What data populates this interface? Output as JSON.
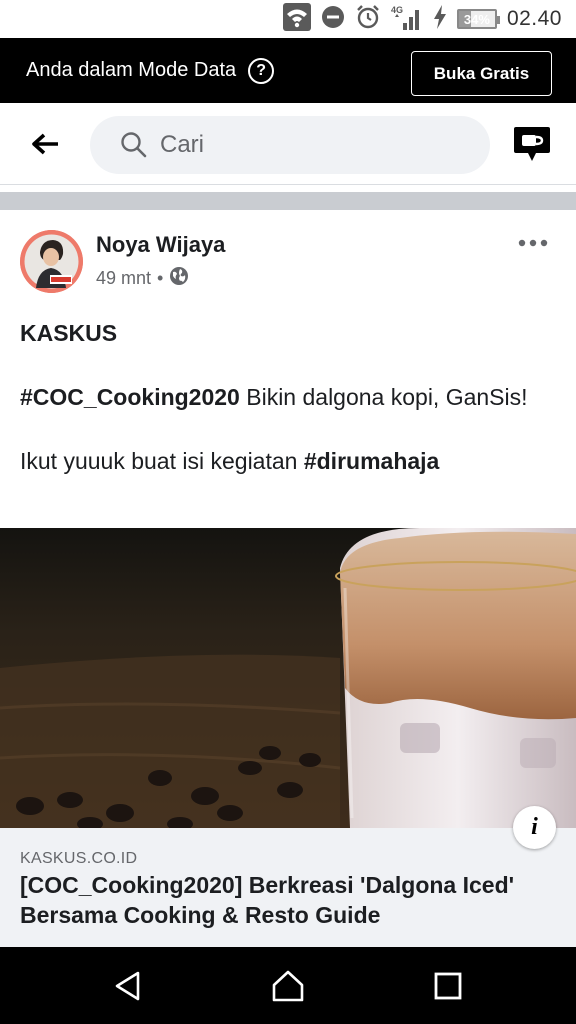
{
  "status_bar": {
    "network_label": "4G",
    "battery_percent": "34%",
    "battery_level": 0.34,
    "time": "02.40"
  },
  "data_mode_banner": {
    "text": "Anda dalam Mode Data",
    "help_icon": "?",
    "open_free_label": "Buka Gratis"
  },
  "header": {
    "search_placeholder": "Cari"
  },
  "post": {
    "author": "Noya Wijaya",
    "time_ago": "49 mnt",
    "dot": "•",
    "privacy_icon": "globe-icon",
    "line1": "KASKUS",
    "hashtag1": "#COC_Cooking2020",
    "line2_rest": " Bikin dalgona kopi, GanSis!",
    "line3_text": "Ikut yuuuk buat isi kegiatan ",
    "hashtag2": "#dirumahaja",
    "link": {
      "domain": "KASKUS.CO.ID",
      "title": "[COC_Cooking2020] Berkreasi 'Dalgona Iced' Bersama Cooking & Resto Guide",
      "info_icon": "i"
    }
  },
  "colors": {
    "banner_bg": "#000000",
    "separator": "#c9ccd1",
    "link_card_bg": "#f0f2f5",
    "search_bg": "#f0f2f5",
    "avatar_ring": "#ee7a6a"
  }
}
